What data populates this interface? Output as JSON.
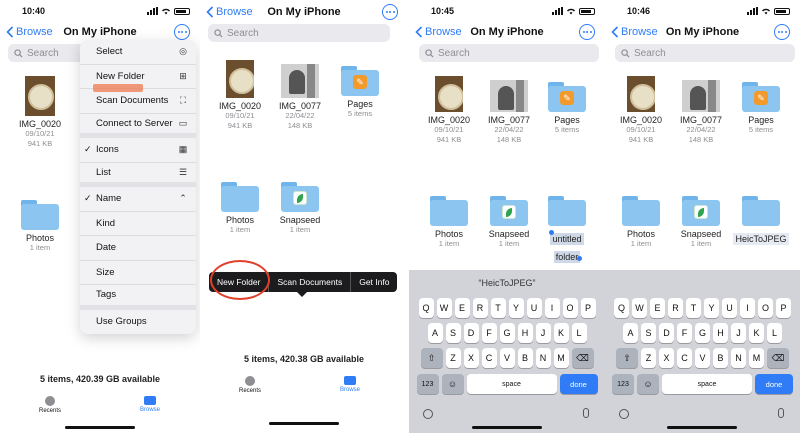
{
  "panel1": {
    "time": "10:40",
    "back_label": "Browse",
    "title": "On My iPhone",
    "search_placeholder": "Search",
    "files": [
      {
        "name": "IMG_0020",
        "date": "09/10/21",
        "size": "941 KB"
      },
      {
        "name": "Photos",
        "count": "1 item"
      }
    ],
    "menu": [
      {
        "label": "Select",
        "icon": "checkmark-circle-icon",
        "glyph": "✓"
      },
      {
        "label": "New Folder",
        "icon": "folder-plus-icon",
        "glyph": "⊞"
      },
      {
        "label": "Scan Documents",
        "icon": "scan-icon",
        "glyph": "⛶"
      },
      {
        "label": "Connect to Server",
        "icon": "monitor-icon",
        "glyph": "▭"
      },
      {
        "label": "Icons",
        "checked": true,
        "icon": "grid-icon",
        "glyph": "▦"
      },
      {
        "label": "List",
        "icon": "list-icon",
        "glyph": "☰"
      },
      {
        "label": "Name",
        "checked": true,
        "icon": "chevron-up-icon",
        "glyph": "^"
      },
      {
        "label": "Kind"
      },
      {
        "label": "Date"
      },
      {
        "label": "Size"
      },
      {
        "label": "Tags"
      },
      {
        "label": "Use Groups"
      }
    ],
    "footer": "5 items, 420.39 GB available",
    "tabs": {
      "recents": "Recents",
      "browse": "Browse"
    }
  },
  "panel2": {
    "back_label": "Browse",
    "title": "On My iPhone",
    "search_placeholder": "Search",
    "files": [
      {
        "name": "IMG_0020",
        "date": "09/10/21",
        "size": "941 KB"
      },
      {
        "name": "IMG_0077",
        "date": "22/04/22",
        "size": "148 KB"
      },
      {
        "name": "Pages",
        "count": "5 items"
      },
      {
        "name": "Photos",
        "count": "1 item"
      },
      {
        "name": "Snapseed",
        "count": "1 item"
      }
    ],
    "context_menu": [
      "New Folder",
      "Scan Documents",
      "Get Info"
    ],
    "footer": "5 items, 420.38 GB available",
    "tabs": {
      "recents": "Recents",
      "browse": "Browse"
    }
  },
  "panel3": {
    "time": "10:45",
    "back_label": "Browse",
    "title": "On My iPhone",
    "search_placeholder": "Search",
    "files": [
      {
        "name": "IMG_0020",
        "date": "09/10/21",
        "size": "941 KB"
      },
      {
        "name": "IMG_0077",
        "date": "22/04/22",
        "size": "148 KB"
      },
      {
        "name": "Pages",
        "count": "5 items"
      },
      {
        "name": "Photos",
        "count": "1 item"
      },
      {
        "name": "Snapseed",
        "count": "1 item"
      }
    ],
    "rename_line1": "untitled",
    "rename_line2": "folder"
  },
  "panel4": {
    "time": "10:46",
    "back_label": "Browse",
    "title": "On My iPhone",
    "search_placeholder": "Search",
    "files": [
      {
        "name": "IMG_0020",
        "date": "09/10/21",
        "size": "941 KB"
      },
      {
        "name": "IMG_0077",
        "date": "22/04/22",
        "size": "148 KB"
      },
      {
        "name": "Pages",
        "count": "5 items"
      },
      {
        "name": "Photos",
        "count": "1 item"
      },
      {
        "name": "Snapseed",
        "count": "1 item"
      }
    ],
    "rename_value": "HeicToJPEG"
  },
  "keyboard": {
    "suggestion": "“HeicToJPEG”",
    "row1": [
      "Q",
      "W",
      "E",
      "R",
      "T",
      "Y",
      "U",
      "I",
      "O",
      "P"
    ],
    "row2": [
      "A",
      "S",
      "D",
      "F",
      "G",
      "H",
      "J",
      "K",
      "L"
    ],
    "row3": [
      "Z",
      "X",
      "C",
      "V",
      "B",
      "N",
      "M"
    ],
    "numbers_key": "123",
    "space_label": "space",
    "done_label": "done"
  },
  "colors": {
    "accent": "#2f7cf6",
    "annotation": "#e0402a"
  }
}
